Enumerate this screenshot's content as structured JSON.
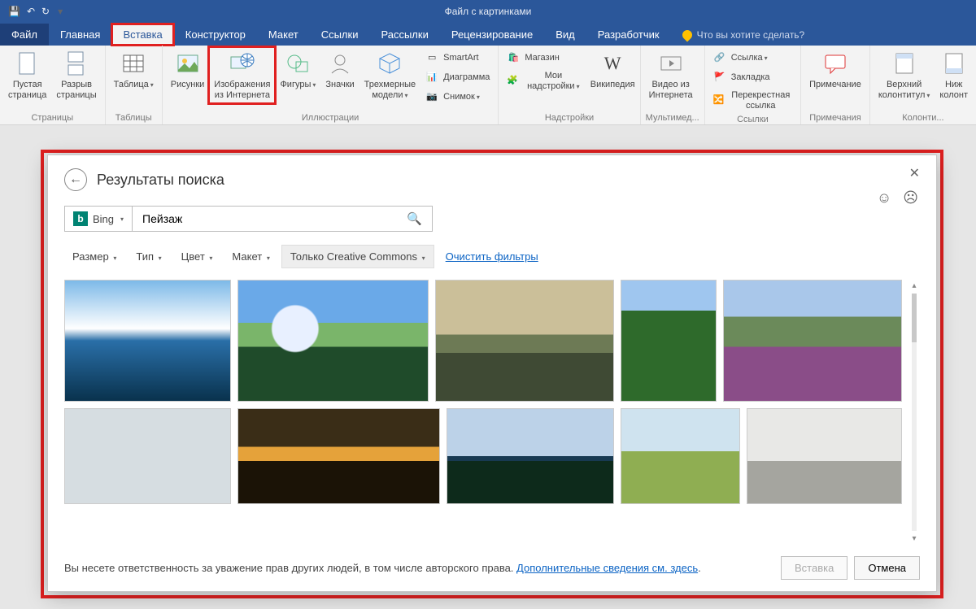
{
  "titlebar": {
    "doc_title": "Файл с картинками"
  },
  "tabs": {
    "file": "Файл",
    "items": [
      "Главная",
      "Вставка",
      "Конструктор",
      "Макет",
      "Ссылки",
      "Рассылки",
      "Рецензирование",
      "Вид",
      "Разработчик"
    ],
    "active": "Вставка",
    "tell_me": "Что вы хотите сделать?"
  },
  "ribbon": {
    "pages": {
      "blank": "Пустая\nстраница",
      "break": "Разрыв\nстраницы",
      "label": "Страницы"
    },
    "tables": {
      "table": "Таблица",
      "label": "Таблицы"
    },
    "illus": {
      "pics": "Рисунки",
      "online": "Изображения\nиз Интернета",
      "shapes": "Фигуры",
      "icons": "Значки",
      "models": "Трехмерные\nмодели",
      "smartart": "SmartArt",
      "chart": "Диаграмма",
      "screenshot": "Снимок",
      "label": "Иллюстрации"
    },
    "addins": {
      "store": "Магазин",
      "myaddins": "Мои надстройки",
      "wiki": "Википедия",
      "label": "Надстройки"
    },
    "media": {
      "video": "Видео из\nИнтернета",
      "label": "Мультимед..."
    },
    "links": {
      "link": "Ссылка",
      "bookmark": "Закладка",
      "crossref": "Перекрестная ссылка",
      "label": "Ссылки"
    },
    "comments": {
      "comment": "Примечание",
      "label": "Примечания"
    },
    "headerfooter": {
      "header": "Верхний\nколонтитул",
      "footer": "Ниж\nколонт",
      "label": "Колонти..."
    }
  },
  "dialog": {
    "title": "Результаты поиска",
    "provider": "Bing",
    "search_value": "Пейзаж",
    "filters": {
      "size": "Размер",
      "type": "Тип",
      "color": "Цвет",
      "layout": "Макет",
      "cc": "Только Creative Commons",
      "clear": "Очистить фильтры"
    },
    "disclaimer_pre": "Вы несете ответственность за уважение прав других людей, в том числе авторского права. ",
    "disclaimer_link": "Дополнительные сведения см. здесь",
    "insert": "Вставка",
    "cancel": "Отмена"
  }
}
